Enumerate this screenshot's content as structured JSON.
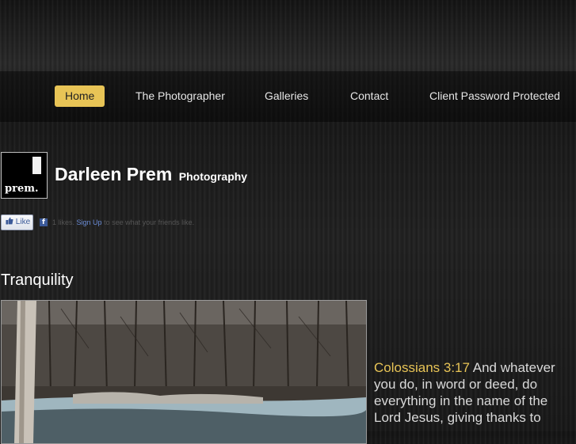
{
  "nav": {
    "items": [
      {
        "label": "Home",
        "active": true
      },
      {
        "label": "The Photographer",
        "active": false
      },
      {
        "label": "Galleries",
        "active": false
      },
      {
        "label": "Contact",
        "active": false
      },
      {
        "label": "Client Password Protected",
        "active": false
      }
    ],
    "active_color": "#e8c456"
  },
  "logo": {
    "text": "prem."
  },
  "site": {
    "name": "Darleen Prem",
    "subtitle": "Photography"
  },
  "facebook": {
    "like_label": "Like",
    "icon": "facebook-icon",
    "likes_text": "1 likes.",
    "signup_label": "Sign Up",
    "tail_text": "to see what your friends like."
  },
  "section": {
    "title": "Tranquility"
  },
  "photo": {
    "subject": "river-forest-photo"
  },
  "quote": {
    "reference": "Colossians 3:17",
    "text": "And whatever you do, in word or deed, do everything in the name of the Lord Jesus, giving thanks to"
  }
}
